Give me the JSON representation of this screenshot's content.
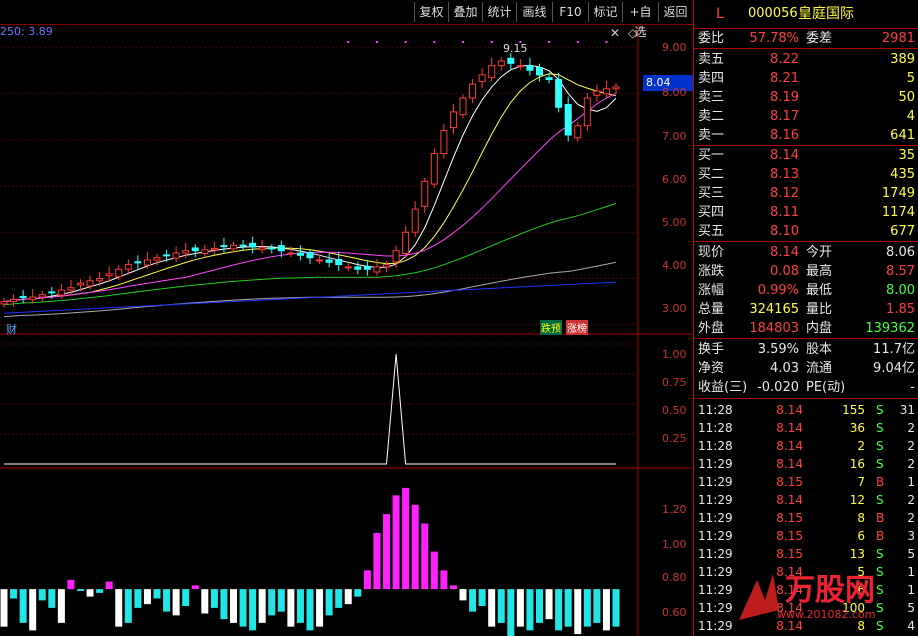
{
  "toolbar": {
    "buttons": [
      "复权",
      "叠加",
      "统计",
      "画线",
      "F10",
      "标记",
      "+自选",
      "返回"
    ],
    "close_icon": "✕",
    "settings_icon": "◇"
  },
  "chart_main": {
    "indicator_label": "250: 3.89",
    "peak_label": "9.15",
    "price_tag": "8.04",
    "y_ticks": [
      "9.00",
      "8.00",
      "7.00",
      "6.00",
      "5.00",
      "4.00",
      "3.00"
    ],
    "bottom_left_label": "财",
    "bottom_badges": [
      "跌预",
      "涨榜"
    ]
  },
  "chart_ind1": {
    "y_ticks": [
      "1.00",
      "0.75",
      "0.50",
      "0.25"
    ]
  },
  "chart_ind2": {
    "y_ticks": [
      "1.20",
      "1.00",
      "0.80",
      "0.60"
    ]
  },
  "panel": {
    "header": {
      "flag": "L",
      "code": "000056",
      "name": "皇庭国际"
    },
    "weibi": {
      "label": "委比",
      "value": "57.78%",
      "label2": "委差",
      "value2": "2981"
    },
    "asks": [
      {
        "label": "卖五",
        "price": "8.22",
        "vol": "389"
      },
      {
        "label": "卖四",
        "price": "8.21",
        "vol": "5"
      },
      {
        "label": "卖三",
        "price": "8.19",
        "vol": "50"
      },
      {
        "label": "卖二",
        "price": "8.17",
        "vol": "4"
      },
      {
        "label": "卖一",
        "price": "8.16",
        "vol": "641"
      }
    ],
    "bids": [
      {
        "label": "买一",
        "price": "8.14",
        "vol": "35"
      },
      {
        "label": "买二",
        "price": "8.13",
        "vol": "435"
      },
      {
        "label": "买三",
        "price": "8.12",
        "vol": "1749"
      },
      {
        "label": "买四",
        "price": "8.11",
        "vol": "1174"
      },
      {
        "label": "买五",
        "price": "8.10",
        "vol": "677"
      }
    ],
    "stats": [
      {
        "l1": "现价",
        "v1": "8.14",
        "l2": "今开",
        "v2": "8.06"
      },
      {
        "l1": "涨跌",
        "v1": "0.08",
        "l2": "最高",
        "v2": "8.57"
      },
      {
        "l1": "涨幅",
        "v1": "0.99%",
        "l2": "最低",
        "v2": "8.00"
      },
      {
        "l1": "总量",
        "v1": "324165",
        "l2": "量比",
        "v2": "1.85"
      },
      {
        "l1": "外盘",
        "v1": "184803",
        "l2": "内盘",
        "v2": "139362"
      }
    ],
    "stats2": [
      {
        "l1": "换手",
        "v1": "3.59%",
        "l2": "股本",
        "v2": "11.7亿"
      },
      {
        "l1": "净资",
        "v1": "4.03",
        "l2": "流通",
        "v2": "9.04亿"
      },
      {
        "l1": "收益(三)",
        "v1": "-0.020",
        "l2": "PE(动)",
        "v2": "-"
      }
    ],
    "ticks": [
      {
        "time": "11:28",
        "price": "8.14",
        "vol": "155",
        "side": "S",
        "n": "31"
      },
      {
        "time": "11:28",
        "price": "8.14",
        "vol": "36",
        "side": "S",
        "n": "2"
      },
      {
        "time": "11:28",
        "price": "8.14",
        "vol": "2",
        "side": "S",
        "n": "2"
      },
      {
        "time": "11:29",
        "price": "8.14",
        "vol": "16",
        "side": "S",
        "n": "2"
      },
      {
        "time": "11:29",
        "price": "8.15",
        "vol": "7",
        "side": "B",
        "n": "1"
      },
      {
        "time": "11:29",
        "price": "8.14",
        "vol": "12",
        "side": "S",
        "n": "2"
      },
      {
        "time": "11:29",
        "price": "8.15",
        "vol": "8",
        "side": "B",
        "n": "2"
      },
      {
        "time": "11:29",
        "price": "8.15",
        "vol": "6",
        "side": "B",
        "n": "3"
      },
      {
        "time": "11:29",
        "price": "8.15",
        "vol": "13",
        "side": "S",
        "n": "5"
      },
      {
        "time": "11:29",
        "price": "8.14",
        "vol": "5",
        "side": "S",
        "n": "1"
      },
      {
        "time": "11:29",
        "price": "8.14",
        "vol": "6",
        "side": "S",
        "n": "1"
      },
      {
        "time": "11:29",
        "price": "8.14",
        "vol": "100",
        "side": "S",
        "n": "5"
      },
      {
        "time": "11:29",
        "price": "8.14",
        "vol": "8",
        "side": "S",
        "n": "4"
      }
    ]
  },
  "watermark": {
    "brand": "万股网",
    "url": "www.201082.com"
  },
  "chart_data": [
    {
      "type": "line",
      "title": "",
      "y_range": [
        2.8,
        9.5
      ],
      "series": [
        {
          "name": "close",
          "values": [
            3.5,
            3.55,
            3.6,
            3.6,
            3.65,
            3.7,
            3.75,
            3.8,
            3.9,
            3.95,
            4.0,
            4.1,
            4.2,
            4.3,
            4.35,
            4.4,
            4.45,
            4.5,
            4.55,
            4.6,
            4.6,
            4.62,
            4.65,
            4.7,
            4.72,
            4.7,
            4.68,
            4.66,
            4.65,
            4.6,
            4.55,
            4.5,
            4.45,
            4.4,
            4.35,
            4.3,
            4.25,
            4.2,
            4.2,
            4.25,
            4.3,
            4.6,
            5.0,
            5.5,
            6.1,
            6.7,
            7.2,
            7.6,
            7.9,
            8.2,
            8.4,
            8.6,
            8.7,
            8.65,
            8.6,
            8.5,
            8.4,
            8.3,
            7.7,
            7.1,
            7.3,
            7.9,
            8.05,
            8.1,
            8.14
          ]
        }
      ]
    },
    {
      "type": "line",
      "title": "",
      "y_range": [
        0,
        1.0
      ],
      "series": [
        {
          "values": [
            0,
            0,
            0,
            0,
            0,
            0,
            0,
            0,
            0,
            0,
            0,
            0,
            0,
            0,
            0,
            0,
            0,
            0,
            0,
            0,
            0,
            0,
            0,
            0,
            0,
            0,
            0,
            0,
            0,
            0,
            0,
            0,
            0,
            0,
            0,
            0,
            0,
            0,
            0,
            0,
            0,
            1,
            0,
            0,
            0,
            0,
            0,
            0,
            0,
            0,
            0,
            0,
            0,
            0,
            0,
            0,
            0,
            0,
            0,
            0,
            0,
            0,
            0,
            0,
            0
          ]
        }
      ]
    },
    {
      "type": "bar",
      "title": "",
      "y_range": [
        0.55,
        1.35
      ],
      "series": [
        {
          "values": [
            0.6,
            0.75,
            0.62,
            0.58,
            0.74,
            0.7,
            0.62,
            0.85,
            0.79,
            0.76,
            0.78,
            0.84,
            0.6,
            0.62,
            0.7,
            0.72,
            0.75,
            0.68,
            0.66,
            0.71,
            0.82,
            0.67,
            0.7,
            0.64,
            0.62,
            0.6,
            0.58,
            0.62,
            0.66,
            0.68,
            0.6,
            0.62,
            0.58,
            0.6,
            0.66,
            0.7,
            0.72,
            0.76,
            0.9,
            1.1,
            1.2,
            1.3,
            1.34,
            1.25,
            1.15,
            1.0,
            0.9,
            0.82,
            0.74,
            0.68,
            0.71,
            0.6,
            0.62,
            0.55,
            0.6,
            0.58,
            0.62,
            0.64,
            0.58,
            0.6,
            0.56,
            0.6,
            0.62,
            0.58,
            0.6
          ]
        }
      ]
    }
  ]
}
